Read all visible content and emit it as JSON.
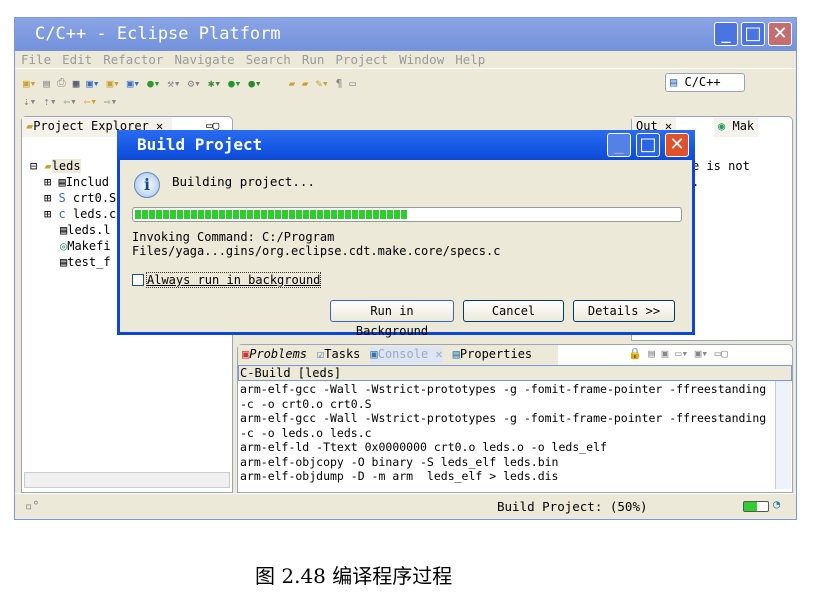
{
  "window": {
    "title": "C/C++ - Eclipse Platform",
    "menu": [
      "File",
      "Edit",
      "Refactor",
      "Navigate",
      "Search",
      "Run",
      "Project",
      "Window",
      "Help"
    ],
    "perspective": "C/C++"
  },
  "explorer": {
    "tab": "Project Explorer",
    "project": "leds",
    "items": [
      "Includ",
      "crt0.S",
      "leds.c",
      "leds.l",
      "Makefi",
      "test_f"
    ]
  },
  "outline": {
    "tabs": [
      "Out",
      "Mak"
    ],
    "text": [
      "e is not",
      "."
    ]
  },
  "dialog": {
    "title": "Build Project",
    "message": "Building project...",
    "progress_percent": 50,
    "command": "Invoking Command: C:/Program Files/yaga...gins/org.eclipse.cdt.make.core/specs.c",
    "checkbox": "Always run in background",
    "checkbox_checked": false,
    "buttons": [
      "Run in Background",
      "Cancel",
      "Details >>"
    ]
  },
  "bottom": {
    "tabs": [
      "Problems",
      "Tasks",
      "Console",
      "Properties"
    ],
    "console_title": "C-Build [leds]",
    "lines": [
      "arm-elf-gcc -Wall -Wstrict-prototypes -g -fomit-frame-pointer -ffreestanding",
      "-c -o crt0.o crt0.S",
      "arm-elf-gcc -Wall -Wstrict-prototypes -g -fomit-frame-pointer -ffreestanding",
      "-c -o leds.o leds.c",
      "arm-elf-ld -Ttext 0x0000000 crt0.o leds.o -o leds_elf",
      "arm-elf-objcopy -O binary -S leds_elf leds.bin",
      "arm-elf-objdump -D -m arm  leds_elf > leds.dis"
    ]
  },
  "status": {
    "text": "Build Project: (50%)"
  },
  "caption": "图 2.48 编译程序过程"
}
